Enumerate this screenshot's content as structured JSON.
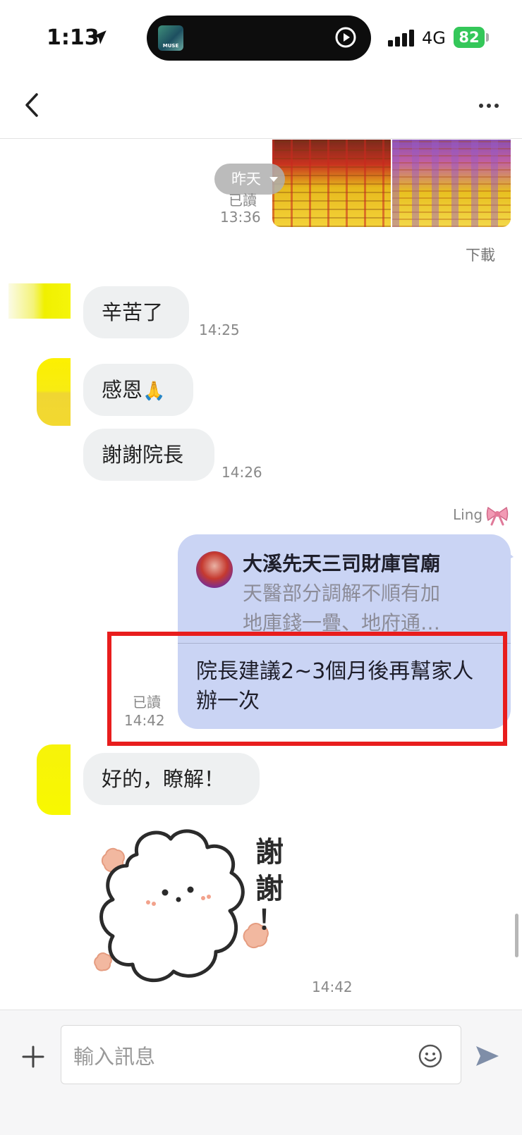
{
  "status_bar": {
    "time": "1:13",
    "network": "4G",
    "battery": "82",
    "island_art_text": "MUSE",
    "battery_color": "#34c759",
    "location_icon": "location-arrow-icon",
    "play_icon": "play-circle-icon",
    "signal_icon": "signal-bars-icon"
  },
  "header": {
    "back_icon": "chevron-left-icon",
    "more_icon": "more-horizontal-icon"
  },
  "messages": {
    "image_pair": {
      "date_chip": "昨天",
      "read": "已讀",
      "time": "13:36",
      "download": "下載"
    },
    "m1": {
      "text": "辛苦了",
      "time": "14:25"
    },
    "m2": {
      "text": "感恩",
      "emoji": "🙏"
    },
    "m3": {
      "text": "謝謝院長",
      "time": "14:26"
    },
    "outgoing": {
      "sender": "Ling",
      "sender_icon": "ribbon-icon",
      "reply_title": "大溪先天三司財庫官廟",
      "reply_line1": "天醫部分調解不順有加",
      "reply_line2": "地庫錢一疊、地府通…",
      "text": "院長建議2~3個月後再幫家人辦一次",
      "read": "已讀",
      "time": "14:42",
      "bubble_color": "#cad4f4",
      "highlight_color": "#e81d1d"
    },
    "m4": {
      "text": "好的，瞭解！"
    },
    "sticker": {
      "text": "謝謝！",
      "time": "14:42"
    }
  },
  "composer": {
    "placeholder": "輸入訊息",
    "plus_icon": "plus-icon",
    "emoji_icon": "smiley-icon",
    "send_icon": "send-icon"
  }
}
